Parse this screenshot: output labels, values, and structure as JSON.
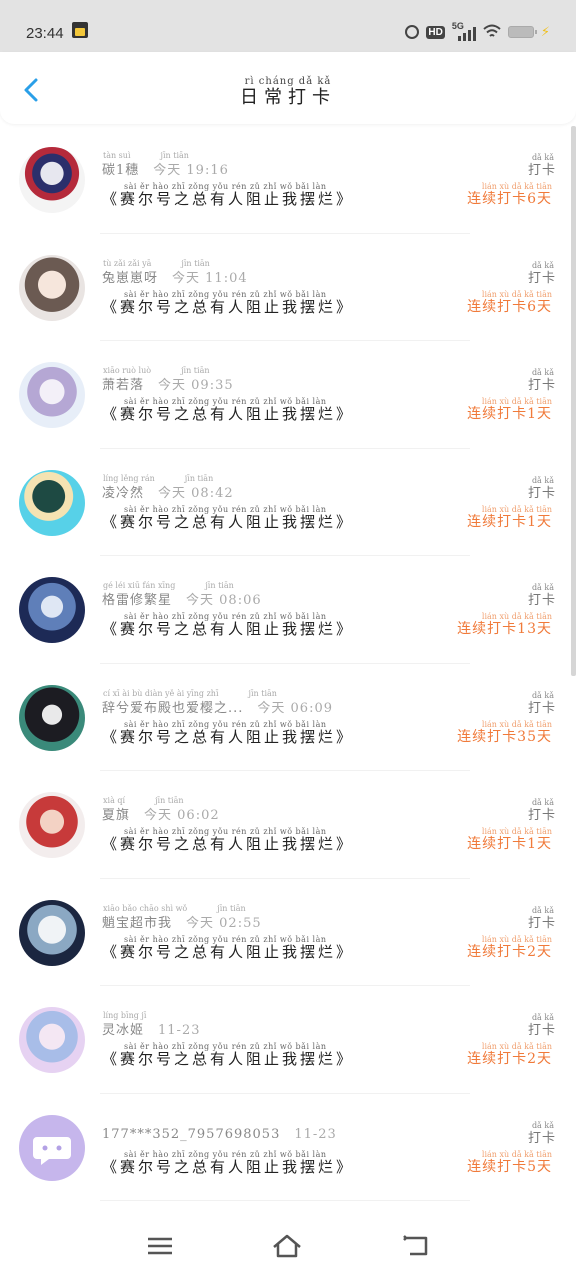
{
  "status": {
    "time": "23:44",
    "network": "5G"
  },
  "header": {
    "title_pinyin": "rì cháng dǎ kǎ",
    "title": "日常打卡"
  },
  "colors": {
    "accent": "#2a9fe8",
    "streak": "#f07a3a"
  },
  "rows": [
    {
      "name_pinyin": "tàn suì",
      "name": "碳1穗",
      "time_pinyin": "jīn tiān",
      "time": "今天 19:16",
      "post_pinyin": "sài ěr hào zhī zǒng yǒu rén zǔ zhǐ wǒ bǎi làn",
      "post": "《赛尔号之总有人阻止我摆烂》",
      "daka_pinyin": "dǎ kǎ",
      "daka": "打卡",
      "streak_pinyin": "lián xù dǎ kǎ tiān",
      "streak": "连续打卡6天"
    },
    {
      "name_pinyin": "tù zǎi zǎi yā",
      "name": "兔崽崽呀",
      "time_pinyin": "jīn tiān",
      "time": "今天 11:04",
      "post_pinyin": "sài ěr hào zhī zǒng yǒu rén zǔ zhǐ wǒ bǎi làn",
      "post": "《赛尔号之总有人阻止我摆烂》",
      "daka_pinyin": "dǎ kǎ",
      "daka": "打卡",
      "streak_pinyin": "lián xù dǎ kǎ tiān",
      "streak": "连续打卡6天"
    },
    {
      "name_pinyin": "xiāo ruò luò",
      "name": "萧若落",
      "time_pinyin": "jīn tiān",
      "time": "今天 09:35",
      "post_pinyin": "sài ěr hào zhī zǒng yǒu rén zǔ zhǐ wǒ bǎi làn",
      "post": "《赛尔号之总有人阻止我摆烂》",
      "daka_pinyin": "dǎ kǎ",
      "daka": "打卡",
      "streak_pinyin": "lián xù dǎ kǎ tiān",
      "streak": "连续打卡1天"
    },
    {
      "name_pinyin": "líng lěng rán",
      "name": "凌冷然",
      "time_pinyin": "jīn tiān",
      "time": "今天 08:42",
      "post_pinyin": "sài ěr hào zhī zǒng yǒu rén zǔ zhǐ wǒ bǎi làn",
      "post": "《赛尔号之总有人阻止我摆烂》",
      "daka_pinyin": "dǎ kǎ",
      "daka": "打卡",
      "streak_pinyin": "lián xù dǎ kǎ tiān",
      "streak": "连续打卡1天"
    },
    {
      "name_pinyin": "gé léi xiū fán xīng",
      "name": "格雷修繁星",
      "time_pinyin": "jīn tiān",
      "time": "今天 08:06",
      "post_pinyin": "sài ěr hào zhī zǒng yǒu rén zǔ zhǐ wǒ bǎi làn",
      "post": "《赛尔号之总有人阻止我摆烂》",
      "daka_pinyin": "dǎ kǎ",
      "daka": "打卡",
      "streak_pinyin": "lián xù dǎ kǎ tiān",
      "streak": "连续打卡13天"
    },
    {
      "name_pinyin": "cí xī ài bù diàn yě ài yīng zhī",
      "name": "辞兮爱布殿也爱樱之...",
      "time_pinyin": "jīn tiān",
      "time": "今天 06:09",
      "post_pinyin": "sài ěr hào zhī zǒng yǒu rén zǔ zhǐ wǒ bǎi làn",
      "post": "《赛尔号之总有人阻止我摆烂》",
      "daka_pinyin": "dǎ kǎ",
      "daka": "打卡",
      "streak_pinyin": "lián xù dǎ kǎ tiān",
      "streak": "连续打卡35天"
    },
    {
      "name_pinyin": "xià qí",
      "name": "夏旗",
      "time_pinyin": "jīn tiān",
      "time": "今天 06:02",
      "post_pinyin": "sài ěr hào zhī zǒng yǒu rén zǔ zhǐ wǒ bǎi làn",
      "post": "《赛尔号之总有人阻止我摆烂》",
      "daka_pinyin": "dǎ kǎ",
      "daka": "打卡",
      "streak_pinyin": "lián xù dǎ kǎ tiān",
      "streak": "连续打卡1天"
    },
    {
      "name_pinyin": "xiāo bǎo chāo shì wǒ",
      "name": "魈宝超市我",
      "time_pinyin": "jīn tiān",
      "time": "今天 02:55",
      "post_pinyin": "sài ěr hào zhī zǒng yǒu rén zǔ zhǐ wǒ bǎi làn",
      "post": "《赛尔号之总有人阻止我摆烂》",
      "daka_pinyin": "dǎ kǎ",
      "daka": "打卡",
      "streak_pinyin": "lián xù dǎ kǎ tiān",
      "streak": "连续打卡2天"
    },
    {
      "name_pinyin": "líng bīng jī",
      "name": "灵冰姬",
      "time_pinyin": "",
      "time": "11-23",
      "post_pinyin": "sài ěr hào zhī zǒng yǒu rén zǔ zhǐ wǒ bǎi làn",
      "post": "《赛尔号之总有人阻止我摆烂》",
      "daka_pinyin": "dǎ kǎ",
      "daka": "打卡",
      "streak_pinyin": "lián xù dǎ kǎ tiān",
      "streak": "连续打卡2天"
    },
    {
      "name_pinyin": "",
      "name": "177***352_7957698053",
      "time_pinyin": "",
      "time": "11-23",
      "post_pinyin": "sài ěr hào zhī zǒng yǒu rén zǔ zhǐ wǒ bǎi làn",
      "post": "《赛尔号之总有人阻止我摆烂》",
      "daka_pinyin": "dǎ kǎ",
      "daka": "打卡",
      "streak_pinyin": "lián xù dǎ kǎ tiān",
      "streak": "连续打卡5天"
    }
  ]
}
